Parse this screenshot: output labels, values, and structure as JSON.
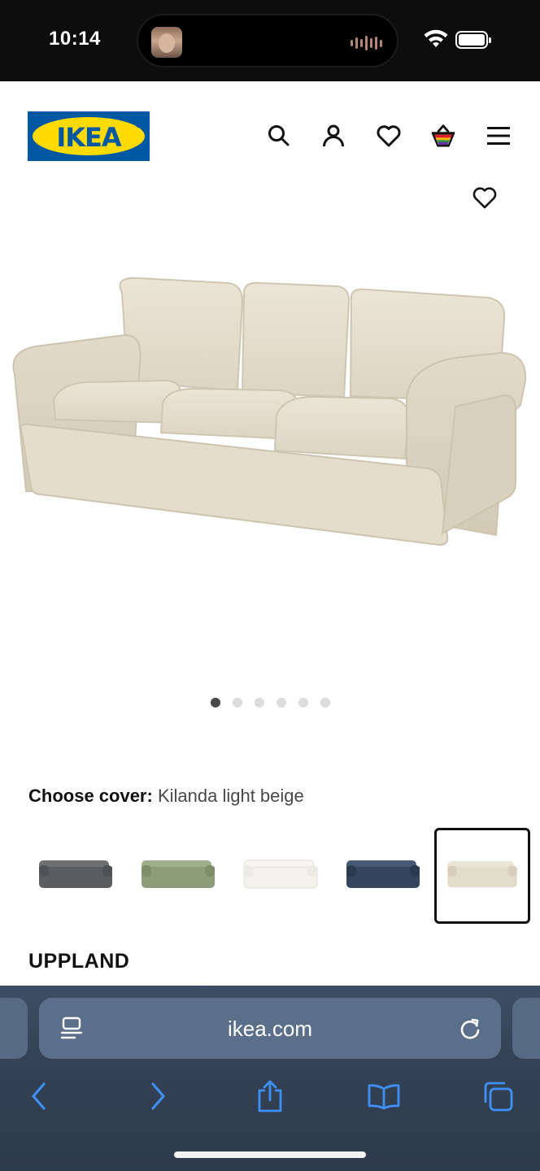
{
  "status_bar": {
    "time": "10:14"
  },
  "header": {
    "logo_text": "IKEA",
    "icons": [
      "search-icon",
      "account-icon",
      "heart-icon",
      "cart-icon",
      "menu-icon"
    ]
  },
  "product": {
    "image_dots": {
      "count": 6,
      "active_index": 0
    },
    "cover_label": "Choose cover:",
    "cover_value": "Kilanda light beige",
    "swatches": [
      {
        "color": "#5b5d5e",
        "selected": false
      },
      {
        "color": "#8d9d79",
        "selected": false
      },
      {
        "color": "#f2f1ea",
        "selected": false
      },
      {
        "color": "#34455d",
        "selected": false
      },
      {
        "color": "#e2dccb",
        "selected": true
      }
    ],
    "name": "UPPLAND"
  },
  "browser": {
    "url": "ikea.com"
  },
  "colors": {
    "ikea_blue": "#0058a3",
    "ikea_yellow": "#ffdb00",
    "browser_accent": "#3f8ff7"
  }
}
